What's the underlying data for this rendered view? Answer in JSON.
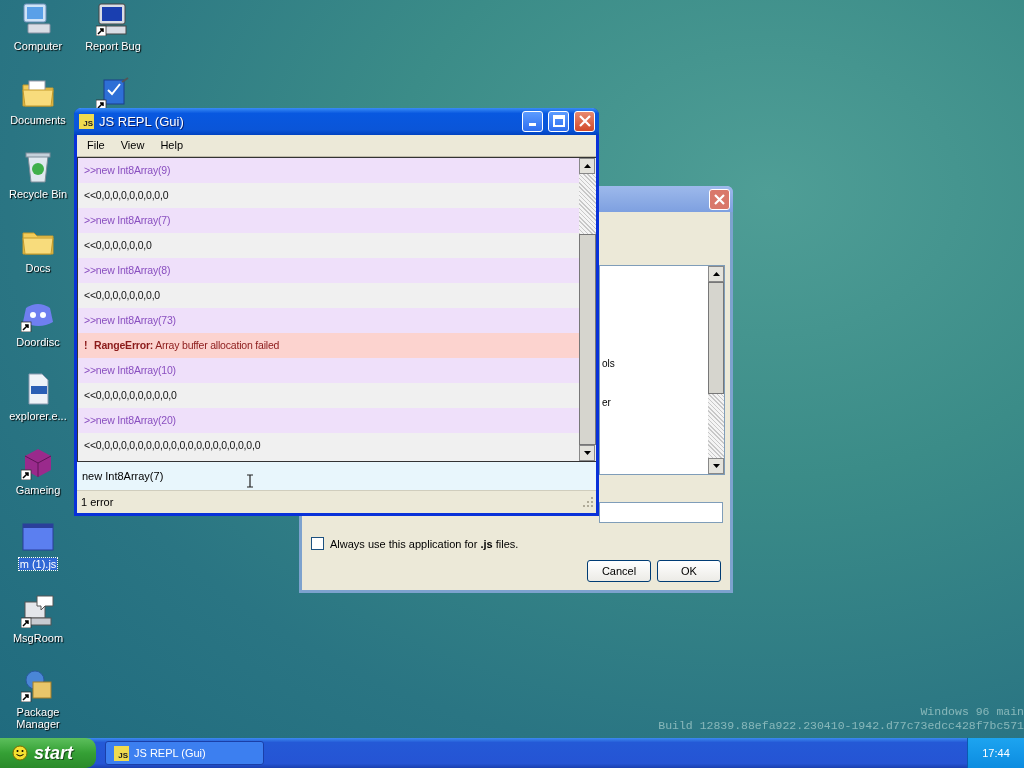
{
  "desktop_icons": [
    {
      "label": "Computer",
      "selected": false
    },
    {
      "label": "Documents",
      "selected": false
    },
    {
      "label": "Recycle Bin",
      "selected": false
    },
    {
      "label": "Docs",
      "selected": false
    },
    {
      "label": "Doordisc",
      "selected": false
    },
    {
      "label": "explorer.e...",
      "selected": false
    },
    {
      "label": "Gameing",
      "selected": false
    },
    {
      "label": "m (1).js",
      "selected": true
    },
    {
      "label": "MsgRoom",
      "selected": false
    },
    {
      "label": "Package Manager",
      "selected": false
    }
  ],
  "desktop_icons_column_2": [
    {
      "label": "Report Bug",
      "selected": false
    }
  ],
  "open_with_dialog": {
    "list_items": [
      "ols",
      "er"
    ],
    "checkbox": {
      "label": "Always use this application for **.js** files.",
      "checked": false
    },
    "buttons": [
      "Cancel",
      "OK"
    ]
  },
  "repl_window": {
    "title": "JS REPL (Gui)",
    "app_icon": "JS",
    "menu": [
      "File",
      "View",
      "Help"
    ],
    "output": [
      {
        "kind": "input",
        "text": ">>new Int8Array(9)"
      },
      {
        "kind": "result",
        "text": "<<0,0,0,0,0,0,0,0,0"
      },
      {
        "kind": "input",
        "text": ">>new Int8Array(7)"
      },
      {
        "kind": "result",
        "text": "<<0,0,0,0,0,0,0"
      },
      {
        "kind": "input",
        "text": ">>new Int8Array(8)"
      },
      {
        "kind": "result",
        "text": "<<0,0,0,0,0,0,0,0"
      },
      {
        "kind": "input",
        "text": ">>new Int8Array(73)"
      },
      {
        "kind": "error",
        "mark": "!",
        "name": "RangeError:",
        "text": "Array buffer allocation failed"
      },
      {
        "kind": "input",
        "text": ">>new Int8Array(10)"
      },
      {
        "kind": "result",
        "text": "<<0,0,0,0,0,0,0,0,0,0"
      },
      {
        "kind": "input",
        "text": ">>new Int8Array(20)"
      },
      {
        "kind": "result",
        "text": "<<0,0,0,0,0,0,0,0,0,0,0,0,0,0,0,0,0,0,0,0"
      }
    ],
    "input": {
      "value": "new Int8Array(7)"
    },
    "status_bar": "1 error"
  },
  "watermark": {
    "line_1": "Windows 96 main",
    "line_2": "Build 12839.88efa922.230410-1942.d77c73edcc428f7bc571"
  },
  "taskbar": {
    "start": "start",
    "tasks": [
      {
        "label": "JS REPL (Gui)",
        "icon": "JS",
        "selected": false
      }
    ],
    "clock": "17:44"
  }
}
